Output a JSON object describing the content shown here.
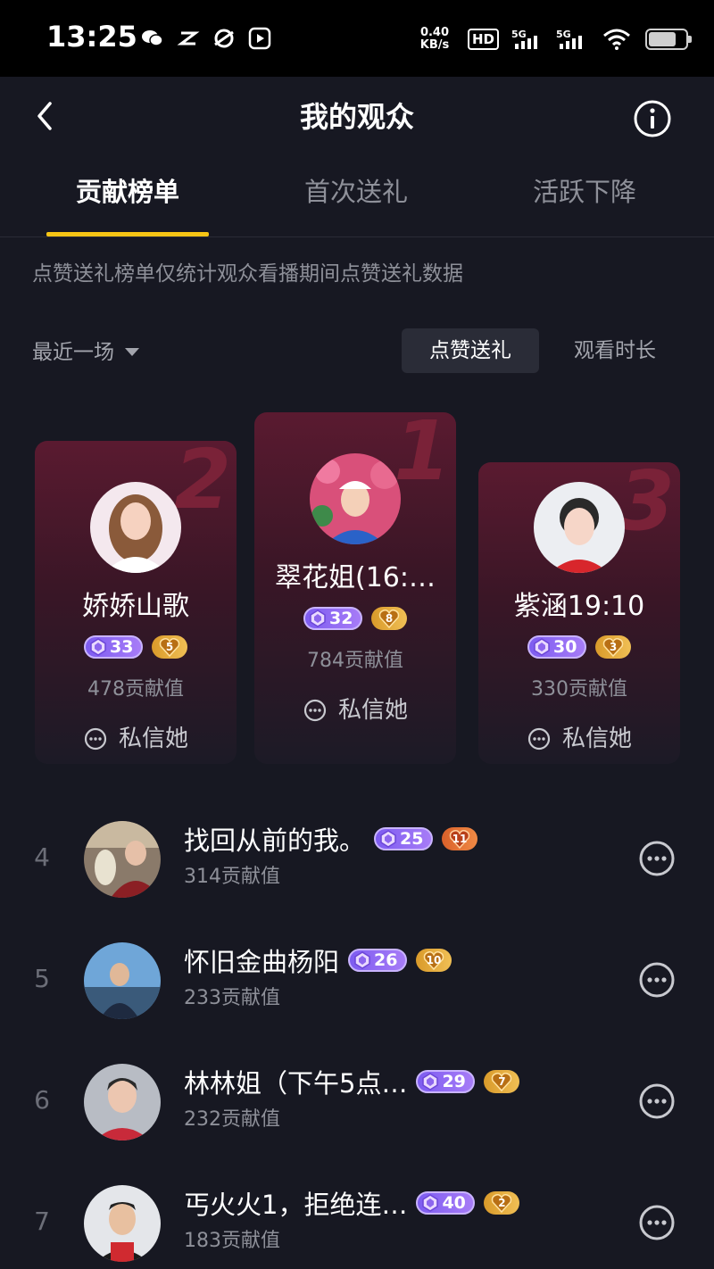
{
  "status_bar": {
    "time": "13:25",
    "net_speed_value": "0.40",
    "net_speed_unit": "KB/s",
    "hd_label": "HD",
    "signal_label_1": "5G",
    "signal_label_2": "5G",
    "left_icons": [
      "wechat-icon",
      "app-icon",
      "browser-icon",
      "video-icon"
    ]
  },
  "header": {
    "title": "我的观众",
    "back_icon": "chevron-left-icon",
    "info_icon": "info-icon"
  },
  "tabs": [
    {
      "label": "贡献榜单",
      "active": true
    },
    {
      "label": "首次送礼",
      "active": false
    },
    {
      "label": "活跃下降",
      "active": false
    }
  ],
  "notice": "点赞送礼榜单仅统计观众看播期间点赞送礼数据",
  "filter": {
    "select_label": "最近一场",
    "segments": [
      {
        "label": "点赞送礼",
        "active": true
      },
      {
        "label": "观看时长",
        "active": false
      }
    ]
  },
  "podium": [
    {
      "rank": "1",
      "name": "翠花姐(16:…",
      "level": "32",
      "fan_level": "8",
      "value": "784贡献值",
      "dm_label": "私信她"
    },
    {
      "rank": "2",
      "name": "娇娇山歌",
      "level": "33",
      "fan_level": "5",
      "value": "478贡献值",
      "dm_label": "私信她"
    },
    {
      "rank": "3",
      "name": "紫涵19:10",
      "level": "30",
      "fan_level": "3",
      "value": "330贡献值",
      "dm_label": "私信她"
    }
  ],
  "list": [
    {
      "rank": "4",
      "name": "找回从前的我。",
      "level": "25",
      "fan_level": "11",
      "value": "314贡献值"
    },
    {
      "rank": "5",
      "name": "怀旧金曲杨阳",
      "level": "26",
      "fan_level": "10",
      "value": "233贡献值"
    },
    {
      "rank": "6",
      "name": "林林姐（下午5点…",
      "level": "29",
      "fan_level": "7",
      "value": "232贡献值"
    },
    {
      "rank": "7",
      "name": "丐火火1，拒绝连…",
      "level": "40",
      "fan_level": "2",
      "value": "183贡献值"
    }
  ],
  "colors": {
    "background": "#171822",
    "accent_underline": "#f7c515",
    "level_badge": "#8b6cf2",
    "fan_badge_gold": "#e3a93c",
    "fan_badge_orange": "#e3703a",
    "card_top": "#5a1a30"
  }
}
